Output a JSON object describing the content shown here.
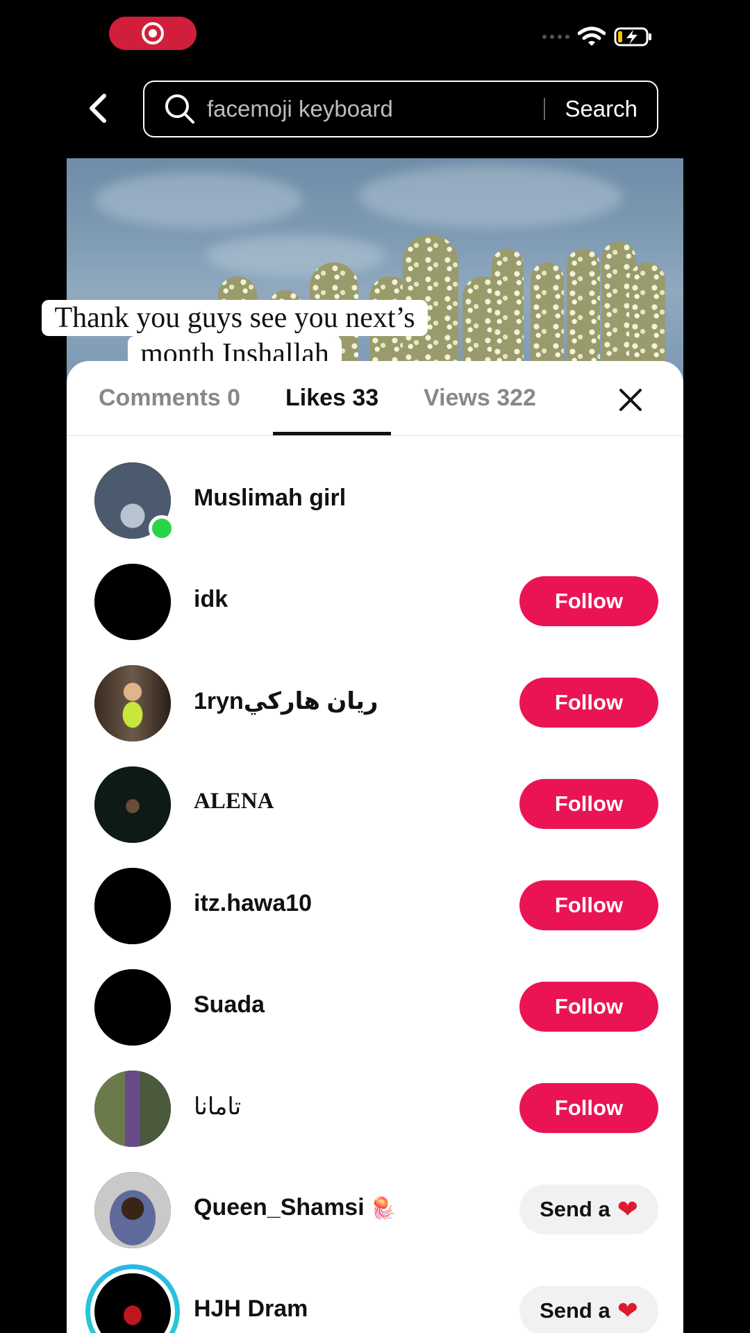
{
  "search": {
    "query": "facemoji keyboard",
    "button_label": "Search"
  },
  "video": {
    "caption_line1": "Thank you guys see you next’s",
    "caption_line2": "month Inshallah"
  },
  "tabs": [
    {
      "label": "Comments 0"
    },
    {
      "label": "Likes 33"
    },
    {
      "label": "Views 322"
    }
  ],
  "users": [
    {
      "name": "Muslimah girl"
    },
    {
      "name": "idk",
      "action": "Follow"
    },
    {
      "name": "1rynريان هاركي",
      "action": "Follow"
    },
    {
      "name": "ALENA",
      "action": "Follow"
    },
    {
      "name": "itz.hawa10",
      "action": "Follow"
    },
    {
      "name": "Suada",
      "action": "Follow"
    },
    {
      "name": "تامانا",
      "action": "Follow"
    },
    {
      "name": "Queen_Shamsi",
      "action": "Send a"
    },
    {
      "name": "HJH Dram",
      "action": "Send a"
    }
  ],
  "colors": {
    "follow": "#ea1454",
    "online": "#28d44a",
    "record": "#d11f3b"
  }
}
